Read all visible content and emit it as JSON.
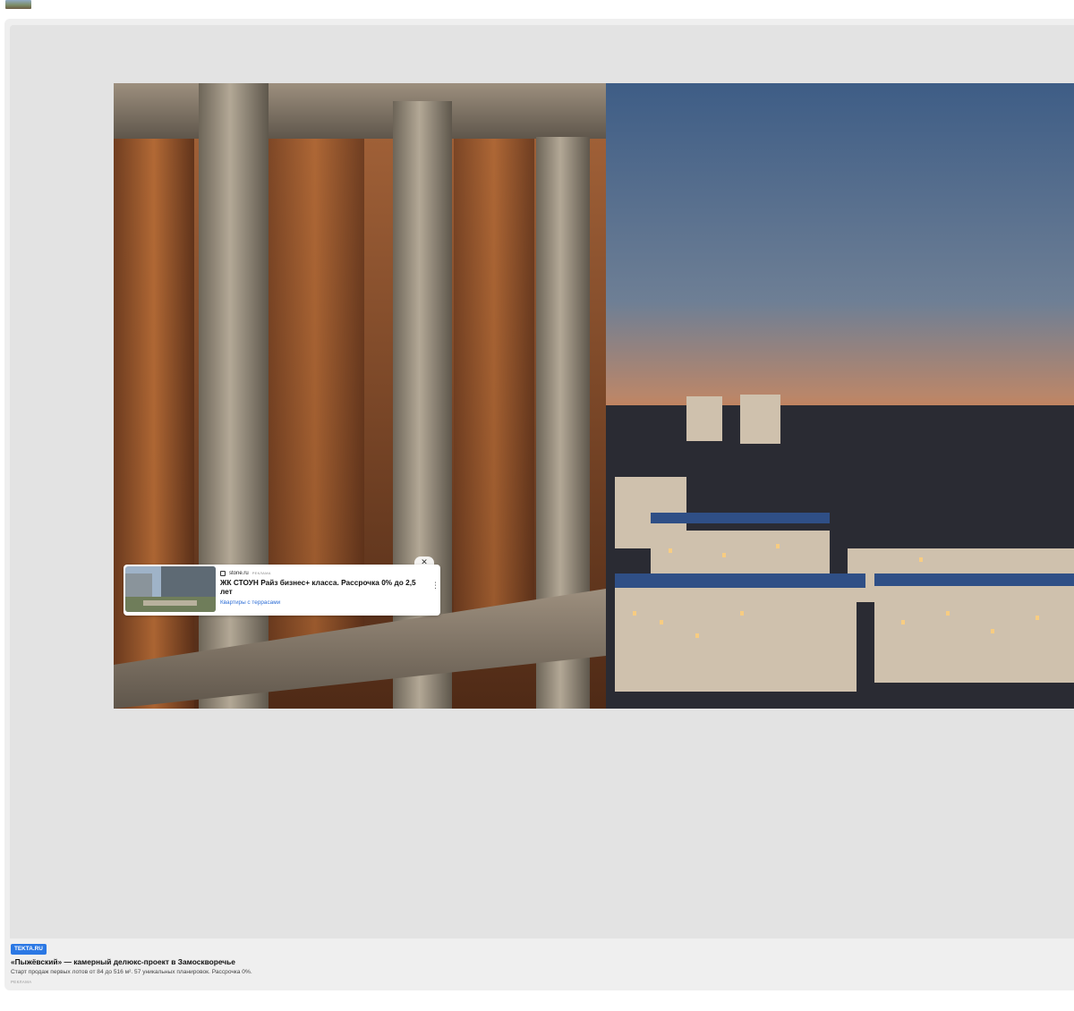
{
  "ad_overlay": {
    "domain": "stone.ru",
    "ad_mark": "РЕКЛАМА",
    "title": "ЖК СТОУН Райз бизнес+ класса. Рассрочка 0% до 2,5 лет",
    "link_label": "Квартиры с террасами",
    "close_glyph": "✕",
    "menu_glyph": "⋮"
  },
  "footer": {
    "badge": "TEKTA.RU",
    "title": "«Пыжёвский» — камерный делюкс-проект в Замоскворечье",
    "description": "Старт продаж первых лотов от 84 до 516 м². 57 уникальных планировок. Рассрочка 0%.",
    "ad_mark": "РЕКЛАМА"
  },
  "colors": {
    "page_background": "#ffffff",
    "card_background": "#efefef",
    "media_background": "#e3e3e3",
    "badge_background": "#2b78e4",
    "link": "#2f6fd6"
  }
}
